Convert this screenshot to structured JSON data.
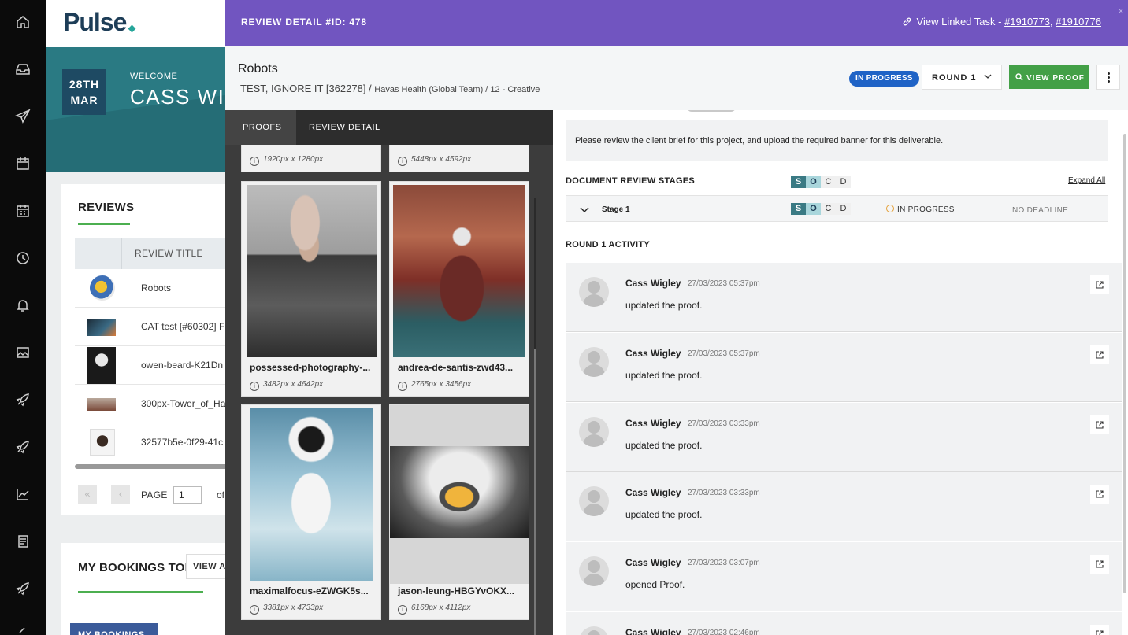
{
  "rail": {
    "icons": [
      "home-icon",
      "inbox-icon",
      "send-icon",
      "calendar-icon",
      "calendar-grid-icon",
      "clock-icon",
      "bell-icon",
      "image-icon",
      "rocket-icon",
      "rocket-icon",
      "chart-icon",
      "document-icon",
      "rocket-icon"
    ]
  },
  "dashboard": {
    "logo": "Pulse",
    "date_day": "28TH",
    "date_month": "MAR",
    "welcome": "WELCOME",
    "user_name": "CASS WIGLEY",
    "reviews": {
      "title": "REVIEWS",
      "column_title": "REVIEW TITLE",
      "rows": [
        {
          "title": "Robots"
        },
        {
          "title": "CAT test [#60302] F"
        },
        {
          "title": "owen-beard-K21Dn"
        },
        {
          "title": "300px-Tower_of_Ha"
        },
        {
          "title": "32577b5e-0f29-41c"
        }
      ],
      "page_label": "PAGE",
      "page_value": "1",
      "of_label": "of"
    },
    "bookings": {
      "title": "MY BOOKINGS TODAY",
      "view_all": "VIEW ALL",
      "button": "MY BOOKINGS"
    }
  },
  "panel": {
    "header_title": "REVIEW DETAIL #ID: 478",
    "linked_prefix": "View Linked Task - ",
    "linked_tasks": [
      "#1910773",
      "#1910776"
    ],
    "linked_sep": ", ",
    "close": "×",
    "proof_name": "Robots",
    "crumb_main": "TEST, IGNORE IT [362278]",
    "crumb_sep": " / ",
    "crumb_rest": "Havas Health (Global Team) / 12 - Creative",
    "status": "IN PROGRESS",
    "round": "ROUND 1",
    "view_proof": "VIEW PROOF",
    "tabs": [
      {
        "label": "PROOFS",
        "active": true
      },
      {
        "label": "REVIEW DETAIL",
        "active": false
      }
    ],
    "proofs": [
      {
        "name": "possessed-photography-...",
        "size": "3482px x 4642px",
        "icon": "robot-photo"
      },
      {
        "name": "andrea-de-santis-zwd43...",
        "size": "2765px x 3456px",
        "icon": "robot-bench-photo"
      },
      {
        "name": "maximalfocus-eZWGK5s...",
        "size": "3381px x 4733px",
        "icon": "asimo-photo"
      },
      {
        "name": "jason-leung-HBGYvOKX...",
        "size": "6168px x 4112px",
        "icon": "walle-photo"
      }
    ],
    "proofs_partial_sizes": [
      "1920px x 1280px",
      "5448px x 4592px"
    ],
    "brief": "Please review the client brief for this project, and upload the required banner for this deliverable.",
    "stages_title": "DOCUMENT REVIEW STAGES",
    "soc_letters": [
      "S",
      "O",
      "C",
      "D"
    ],
    "expand_all": "Expand All",
    "stage": {
      "name": "Stage 1",
      "status": "IN PROGRESS",
      "deadline": "NO DEADLINE"
    },
    "round_activity_title": "ROUND 1 ACTIVITY",
    "activity": [
      {
        "name": "Cass Wigley",
        "time": "27/03/2023 05:37pm",
        "text": "updated the proof."
      },
      {
        "name": "Cass Wigley",
        "time": "27/03/2023 05:37pm",
        "text": "updated the proof."
      },
      {
        "name": "Cass Wigley",
        "time": "27/03/2023 03:33pm",
        "text": "updated the proof."
      },
      {
        "name": "Cass Wigley",
        "time": "27/03/2023 03:33pm",
        "text": "updated the proof."
      },
      {
        "name": "Cass Wigley",
        "time": "27/03/2023 03:07pm",
        "text": "opened Proof."
      },
      {
        "name": "Cass Wigley",
        "time": "27/03/2023 02:46pm",
        "text": ""
      }
    ]
  },
  "colors": {
    "header_purple": "#7155c0",
    "teal": "#2a7a83",
    "status_blue": "#1f63c6",
    "proof_green": "#43a047"
  }
}
